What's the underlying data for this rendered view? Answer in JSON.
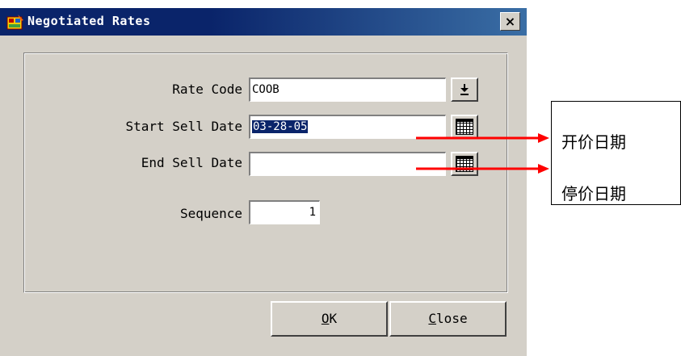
{
  "window": {
    "title": "Negotiated Rates",
    "close_glyph": "×"
  },
  "form": {
    "rate_code": {
      "label": "Rate Code",
      "value": "COOB"
    },
    "start_sell_date": {
      "label": "Start Sell Date",
      "value": "03-28-05"
    },
    "end_sell_date": {
      "label": "End Sell Date",
      "value": ""
    },
    "sequence": {
      "label": "Sequence",
      "value": "1"
    }
  },
  "buttons": {
    "ok": {
      "mnemonic": "O",
      "rest": "K"
    },
    "close": {
      "mnemonic": "C",
      "rest": "lose"
    },
    "dropdown_glyph": "⤓"
  },
  "annotation": {
    "start_label": "开价日期",
    "end_label": "停价日期",
    "arrow_color": "#ff0000"
  },
  "icons": [
    "app-icon",
    "close-icon",
    "dropdown-arrow-icon",
    "calendar-icon"
  ]
}
